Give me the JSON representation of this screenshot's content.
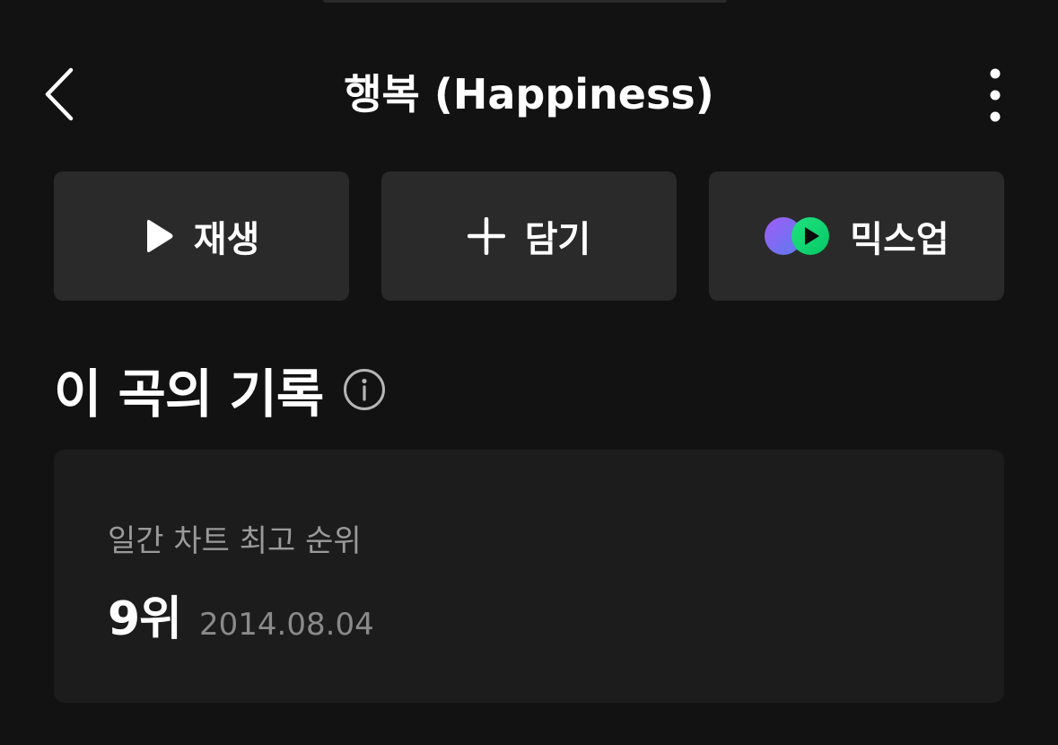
{
  "header": {
    "title": "행복 (Happiness)",
    "back_icon": "chevron-left-icon",
    "more_icon": "more-vertical-icon"
  },
  "actions": [
    {
      "label": "재생",
      "icon": "play-icon"
    },
    {
      "label": "담기",
      "icon": "plus-icon"
    },
    {
      "label": "믹스업",
      "icon": "mixup-logo-icon"
    }
  ],
  "section": {
    "title": "이 곡의 기록",
    "info_icon": "info-icon"
  },
  "record": {
    "label": "일간 차트 최고 순위",
    "rank": "9위",
    "date": "2014.08.04"
  },
  "colors": {
    "background": "#121212",
    "button_bg": "#2a2a2a",
    "card_bg": "#1c1c1c",
    "text_primary": "#ffffff",
    "text_secondary": "#9a9a9a",
    "mixup_purple": "#8b5cf6",
    "mixup_green": "#10e27a"
  }
}
